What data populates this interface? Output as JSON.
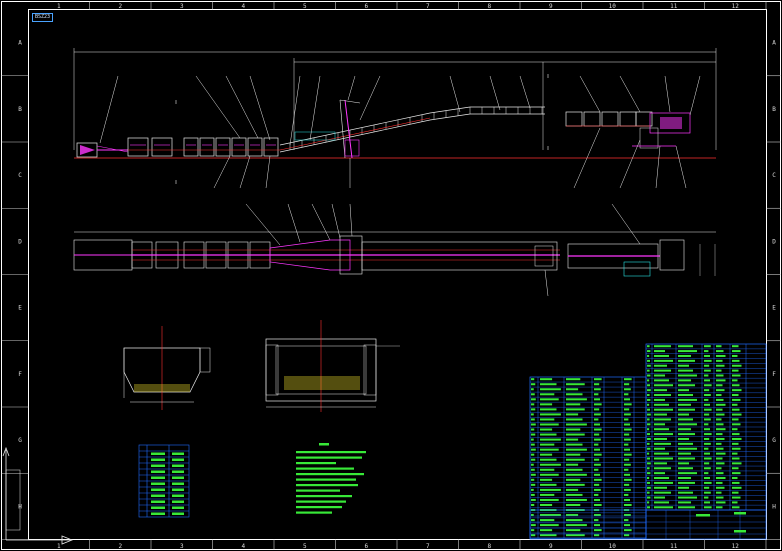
{
  "drawing": {
    "tag": "BSZ23",
    "column_numbers": [
      "1",
      "2",
      "3",
      "4",
      "5",
      "6",
      "7",
      "8",
      "9",
      "10",
      "11",
      "12"
    ],
    "row_letters": [
      "A",
      "B",
      "C",
      "D",
      "E",
      "F",
      "G",
      "H"
    ]
  },
  "colors": {
    "background": "#000000",
    "frame": "#ffffff",
    "table_lines": "#1f6bff",
    "cyan_lines": "#27e3e3",
    "magenta_parts": "#ff37ff",
    "green_text": "#38e838",
    "red_lines": "#ff3030",
    "yellow_lines": "#f2e02a"
  },
  "icons": {
    "ucs": "ucs-axis-icon"
  }
}
